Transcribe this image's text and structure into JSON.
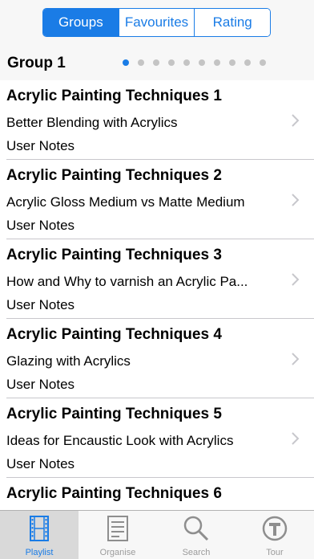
{
  "segments": [
    {
      "label": "Groups",
      "active": true
    },
    {
      "label": "Favourites",
      "active": false
    },
    {
      "label": "Rating",
      "active": false
    }
  ],
  "group": {
    "title": "Group 1",
    "page_count": 10,
    "current_page": 1
  },
  "items": [
    {
      "title": "Acrylic Painting Techniques 1",
      "subtitle": "Better Blending with Acrylics",
      "notes": "User Notes"
    },
    {
      "title": "Acrylic Painting Techniques 2",
      "subtitle": "Acrylic Gloss Medium vs Matte Medium",
      "notes": "User Notes"
    },
    {
      "title": "Acrylic Painting Techniques 3",
      "subtitle": "How and Why to varnish an Acrylic Pa...",
      "notes": "User Notes"
    },
    {
      "title": "Acrylic Painting Techniques 4",
      "subtitle": "Glazing with Acrylics",
      "notes": "User Notes"
    },
    {
      "title": "Acrylic Painting Techniques 5",
      "subtitle": "Ideas for Encaustic Look with Acrylics",
      "notes": "User Notes"
    },
    {
      "title": "Acrylic Painting Techniques 6",
      "subtitle": "",
      "notes": ""
    }
  ],
  "tabs": [
    {
      "label": "Playlist",
      "icon": "film-strip-icon",
      "active": true
    },
    {
      "label": "Organise",
      "icon": "list-icon",
      "active": false
    },
    {
      "label": "Search",
      "icon": "search-icon",
      "active": false
    },
    {
      "label": "Tour",
      "icon": "tour-icon",
      "active": false
    }
  ],
  "colors": {
    "accent": "#1a7ce6",
    "tab_inactive": "#9b9b9b",
    "divider": "#c8c7cc"
  }
}
